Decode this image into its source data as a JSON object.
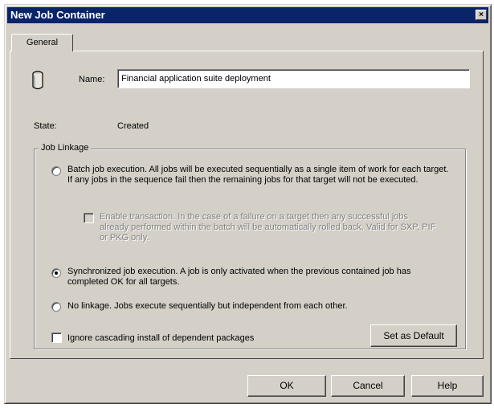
{
  "window": {
    "title": "New Job Container",
    "close_glyph": "×"
  },
  "tabs": [
    {
      "label": "General"
    }
  ],
  "general": {
    "name_label": "Name:",
    "name_value": "Financial application suite deployment",
    "state_label": "State:",
    "state_value": "Created",
    "icon": "container-icon"
  },
  "job_linkage": {
    "legend": "Job Linkage",
    "options": [
      {
        "label": "Batch job execution. All jobs will be executed sequentially as a single item of work for each target. If any jobs in the sequence fail then the remaining jobs for that target will not be executed.",
        "selected": false
      },
      {
        "label": "Synchronized job execution. A job is only activated when the previous contained job has completed OK for all targets.",
        "selected": true
      },
      {
        "label": "No linkage. Jobs execute sequentially but independent from each other.",
        "selected": false
      }
    ],
    "transaction": {
      "label": "Enable transaction. In the case of a failure on a target then any successful jobs already performed within the batch will be automatically rolled back. Valid for SXP, PIF or PKG only.",
      "checked": false,
      "enabled": false
    },
    "ignore_cascading": {
      "label": "Ignore cascading install of dependent packages",
      "checked": false
    },
    "set_default_label": "Set as Default"
  },
  "buttons": {
    "ok": "OK",
    "cancel": "Cancel",
    "help": "Help"
  }
}
